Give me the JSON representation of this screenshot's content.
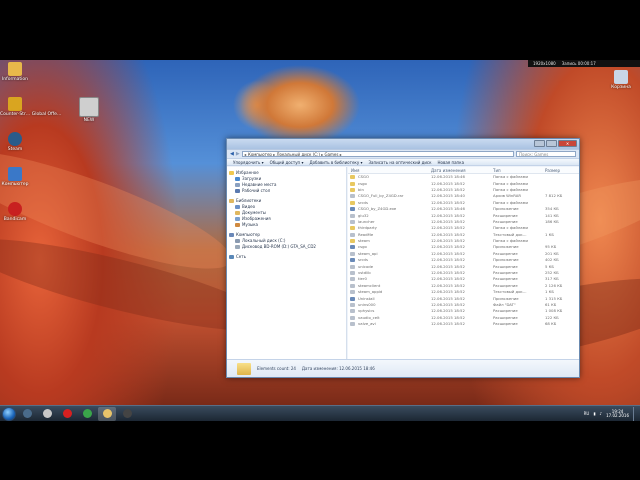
{
  "desktop_icons": [
    {
      "label": "Information",
      "icon": "folder-icon",
      "color": "#e8b84a"
    },
    {
      "label": "Counter-Str… Global Offe…",
      "icon": "csgo-icon",
      "color": "#d9a520"
    },
    {
      "label": "Steam",
      "icon": "steam-icon",
      "color": "#2a5b8a"
    },
    {
      "label": "Компьютер",
      "icon": "computer-icon",
      "color": "#3a78c8"
    },
    {
      "label": "Bandicam",
      "icon": "bandicam-icon",
      "color": "#c82020"
    },
    {
      "label": "Корзина",
      "icon": "recycle-bin-icon",
      "color": "#c9d6e6"
    },
    {
      "label": "NEW",
      "icon": "zip-folder-icon",
      "color": "#cfcfcf"
    }
  ],
  "recording_bar": {
    "resolution": "1920x1080",
    "status": "Запись 00:00:17"
  },
  "explorer": {
    "address": "▸ Компьютер ▸ Локальный диск (C:) ▸ Games ▸",
    "search_placeholder": "Поиск: Games",
    "toolbar": [
      "Упорядочить ▾",
      "Общий доступ ▾",
      "Добавить в библиотеку ▾",
      "Записать на оптический диск",
      "Новая папка"
    ],
    "nav": [
      "Избранное",
      "Загрузки",
      "Недавние места",
      "Рабочий стол",
      "Библиотеки",
      "Видео",
      "Документы",
      "Изображения",
      "Музыка",
      "Компьютер",
      "Локальный диск (C:)",
      "Дисковод BD-ROM (D:) GTA_SA_CD2",
      "Сеть"
    ],
    "columns": [
      "Имя",
      "Дата изменения",
      "Тип",
      "Размер"
    ],
    "files": [
      {
        "name": "CSGO",
        "date": "12.06.2015 18:46",
        "type": "Папка с файлами",
        "size": ""
      },
      {
        "name": "csgo",
        "date": "12.06.2015 18:52",
        "type": "Папка с файлами",
        "size": ""
      },
      {
        "name": "bin",
        "date": "12.06.2015 18:52",
        "type": "Папка с файлами",
        "size": ""
      },
      {
        "name": "CSGO_Full_by_Z4GD.rar",
        "date": "12.06.2015 18:40",
        "type": "Архив WinRAR",
        "size": "7 812 КБ"
      },
      {
        "name": "srcds",
        "date": "12.06.2015 18:52",
        "type": "Папка с файлами",
        "size": ""
      },
      {
        "name": "CSGO_by_Z4GD.exe",
        "date": "12.06.2015 18:46",
        "type": "Приложение",
        "size": "354 КБ"
      },
      {
        "name": "glu32",
        "date": "12.06.2015 18:52",
        "type": "Расширение",
        "size": "141 КБ"
      },
      {
        "name": "launcher",
        "date": "12.06.2015 18:52",
        "type": "Расширение",
        "size": "186 КБ"
      },
      {
        "name": "thirdparty",
        "date": "12.06.2015 18:52",
        "type": "Папка с файлами",
        "size": ""
      },
      {
        "name": "ReadMe",
        "date": "12.06.2015 18:52",
        "type": "Текстовый док…",
        "size": "1 КБ"
      },
      {
        "name": "steam",
        "date": "12.06.2015 18:52",
        "type": "Папка с файлами",
        "size": ""
      },
      {
        "name": "csgo",
        "date": "12.06.2015 18:52",
        "type": "Приложение",
        "size": "95 КБ"
      },
      {
        "name": "steam_api",
        "date": "12.06.2015 18:52",
        "type": "Расширение",
        "size": "201 КБ"
      },
      {
        "name": "srcds",
        "date": "12.06.2015 18:52",
        "type": "Приложение",
        "size": "402 КБ"
      },
      {
        "name": "unicode",
        "date": "12.06.2015 18:52",
        "type": "Расширение",
        "size": "5 КБ"
      },
      {
        "name": "vstdlib",
        "date": "12.06.2015 18:52",
        "type": "Расширение",
        "size": "252 КБ"
      },
      {
        "name": "tier0",
        "date": "12.06.2015 18:52",
        "type": "Расширение",
        "size": "317 КБ"
      },
      {
        "name": "steamclient",
        "date": "12.06.2015 18:52",
        "type": "Расширение",
        "size": "2 126 КБ"
      },
      {
        "name": "steam_appid",
        "date": "12.06.2015 18:52",
        "type": "Текстовый док…",
        "size": "1 КБ"
      },
      {
        "name": "Uninstall",
        "date": "12.06.2015 18:52",
        "type": "Приложение",
        "size": "1 315 КБ"
      },
      {
        "name": "unins000",
        "date": "12.06.2015 18:52",
        "type": "Файл \"DAT\"",
        "size": "61 КБ"
      },
      {
        "name": "vphysics",
        "date": "12.06.2015 18:52",
        "type": "Расширение",
        "size": "1 008 КБ"
      },
      {
        "name": "vaudio_celt",
        "date": "12.06.2015 18:52",
        "type": "Расширение",
        "size": "122 КБ"
      },
      {
        "name": "valve_avi",
        "date": "12.06.2015 18:52",
        "type": "Расширение",
        "size": "68 КБ"
      }
    ],
    "details": {
      "name": "Elements count: 24",
      "date": "Дата изменения: 12.06.2015 18:46"
    }
  },
  "taskbar": {
    "apps": [
      {
        "icon": "steam-icon",
        "color": "#4a6b8a"
      },
      {
        "icon": "csgo-icon",
        "color": "#c8c8c8"
      },
      {
        "icon": "bandicam-icon",
        "color": "#d82020"
      },
      {
        "icon": "chrome-icon",
        "color": "#3aa54a"
      },
      {
        "icon": "explorer-icon",
        "color": "#e8c36a"
      },
      {
        "icon": "monitor-icon",
        "color": "#444"
      }
    ],
    "lang": "RU",
    "time": "19:24",
    "date": "17.02.2016"
  }
}
